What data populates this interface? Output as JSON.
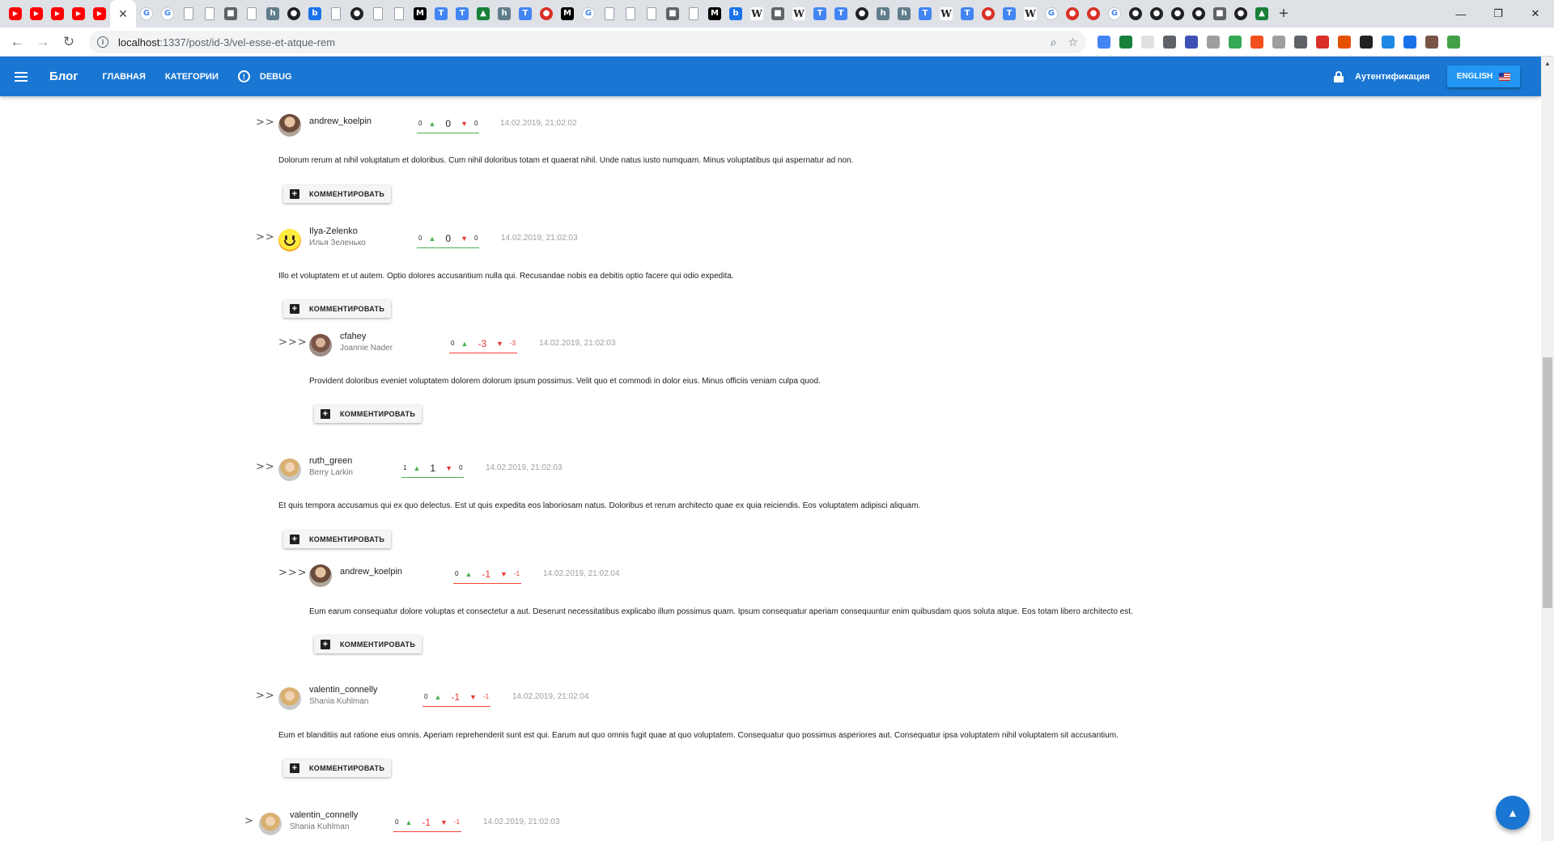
{
  "browser": {
    "active_tab_close": "✕",
    "new_tab": "+",
    "window": {
      "minimize": "—",
      "restore": "❐",
      "close": "✕"
    },
    "url_host": "localhost",
    "url_path": ":1337/post/id-3/vel-esse-et-atque-rem",
    "tab_favicons": [
      "yt",
      "yt",
      "yt",
      "yt",
      "yt",
      "g",
      "g",
      "doc",
      "doc",
      "misc",
      "doc",
      "h",
      "gh",
      "blue",
      "doc",
      "gh",
      "doc",
      "doc",
      "dark",
      "tr",
      "tr",
      "green",
      "h",
      "tr",
      "red",
      "dark",
      "g",
      "doc",
      "doc",
      "doc",
      "misc",
      "doc",
      "dark",
      "blue",
      "w",
      "misc",
      "w",
      "tr",
      "tr",
      "gh",
      "h",
      "h",
      "tr",
      "w",
      "tr",
      "red",
      "tr",
      "w",
      "g",
      "red",
      "red",
      "g",
      "gh",
      "gh",
      "gh",
      "gh",
      "misc",
      "gh",
      "green"
    ]
  },
  "app": {
    "brand": "Блог",
    "nav": {
      "home": "ГЛАВНАЯ",
      "categories": "КАТЕГОРИИ",
      "debug": "DEBUG"
    },
    "auth_label": "Аутентификация",
    "language_label": "ENGLISH",
    "reply_label": "КОММЕНТИРОВАТЬ"
  },
  "comments": [
    {
      "chevrons": ">>",
      "username": "andrew_koelpin",
      "fullname": "",
      "likes": "0",
      "score": "0",
      "dislikes": "0",
      "date": "14.02.2019, 21:02:02",
      "text": "Dolorum rerum at nihil voluptatum et doloribus. Cum nihil doloribus totam et quaerat nihil. Unde natus iusto numquam. Minus voluptatibus qui aspernatur ad non."
    },
    {
      "chevrons": ">>",
      "username": "Ilya-Zelenko",
      "fullname": "Илья Зеленько",
      "likes": "0",
      "score": "0",
      "dislikes": "0",
      "date": "14.02.2019, 21:02:03",
      "text": "Illo et voluptatem et ut autem. Optio dolores accusantium nulla qui. Recusandae nobis ea debitis optio facere qui odio expedita."
    },
    {
      "chevrons": ">>>",
      "username": "cfahey",
      "fullname": "Joannie Nader",
      "likes": "0",
      "score": "-3",
      "dislikes": "-3",
      "date": "14.02.2019, 21:02:03",
      "text": "Provident doloribus eveniet voluptatem dolorem dolorum ipsum possimus. Velit quo et commodi in dolor eius. Minus officiis veniam culpa quod."
    },
    {
      "chevrons": ">>",
      "username": "ruth_green",
      "fullname": "Berry Larkin",
      "likes": "1",
      "score": "1",
      "dislikes": "0",
      "date": "14.02.2019, 21:02:03",
      "text": "Et quis tempora accusamus qui ex quo delectus. Est ut quis expedita eos laboriosam natus. Doloribus et rerum architecto quae ex quia reiciendis. Eos voluptatem adipisci aliquam."
    },
    {
      "chevrons": ">>>",
      "username": "andrew_koelpin",
      "fullname": "",
      "likes": "0",
      "score": "-1",
      "dislikes": "-1",
      "date": "14.02.2019, 21:02:04",
      "text": "Eum earum consequatur dolore voluptas et consectetur a aut. Deserunt necessitatibus explicabo illum possimus quam. Ipsum consequatur aperiam consequuntur enim quibusdam quos soluta atque. Eos totam libero architecto est."
    },
    {
      "chevrons": ">>",
      "username": "valentin_connelly",
      "fullname": "Shania Kuhlman",
      "likes": "0",
      "score": "-1",
      "dislikes": "-1",
      "date": "14.02.2019, 21:02:04",
      "text": "Eum et blanditiis aut ratione eius omnis. Aperiam reprehenderit sunt est qui. Earum aut quo omnis fugit quae at quo voluptatem. Consequatur quo possimus asperiores aut. Consequatur ipsa voluptatem nihil voluptatem sit accusantium."
    },
    {
      "chevrons": ">",
      "username": "valentin_connelly",
      "fullname": "Shania Kuhlman",
      "likes": "0",
      "score": "-1",
      "dislikes": "-1",
      "date": "14.02.2019, 21:02:03",
      "text": ""
    }
  ],
  "colors": {
    "appbar": "#1976d2",
    "like": "#4caf50",
    "dislike": "#e53935",
    "date": "#9e9e9e"
  },
  "fab_icon": "chevron-up-icon"
}
